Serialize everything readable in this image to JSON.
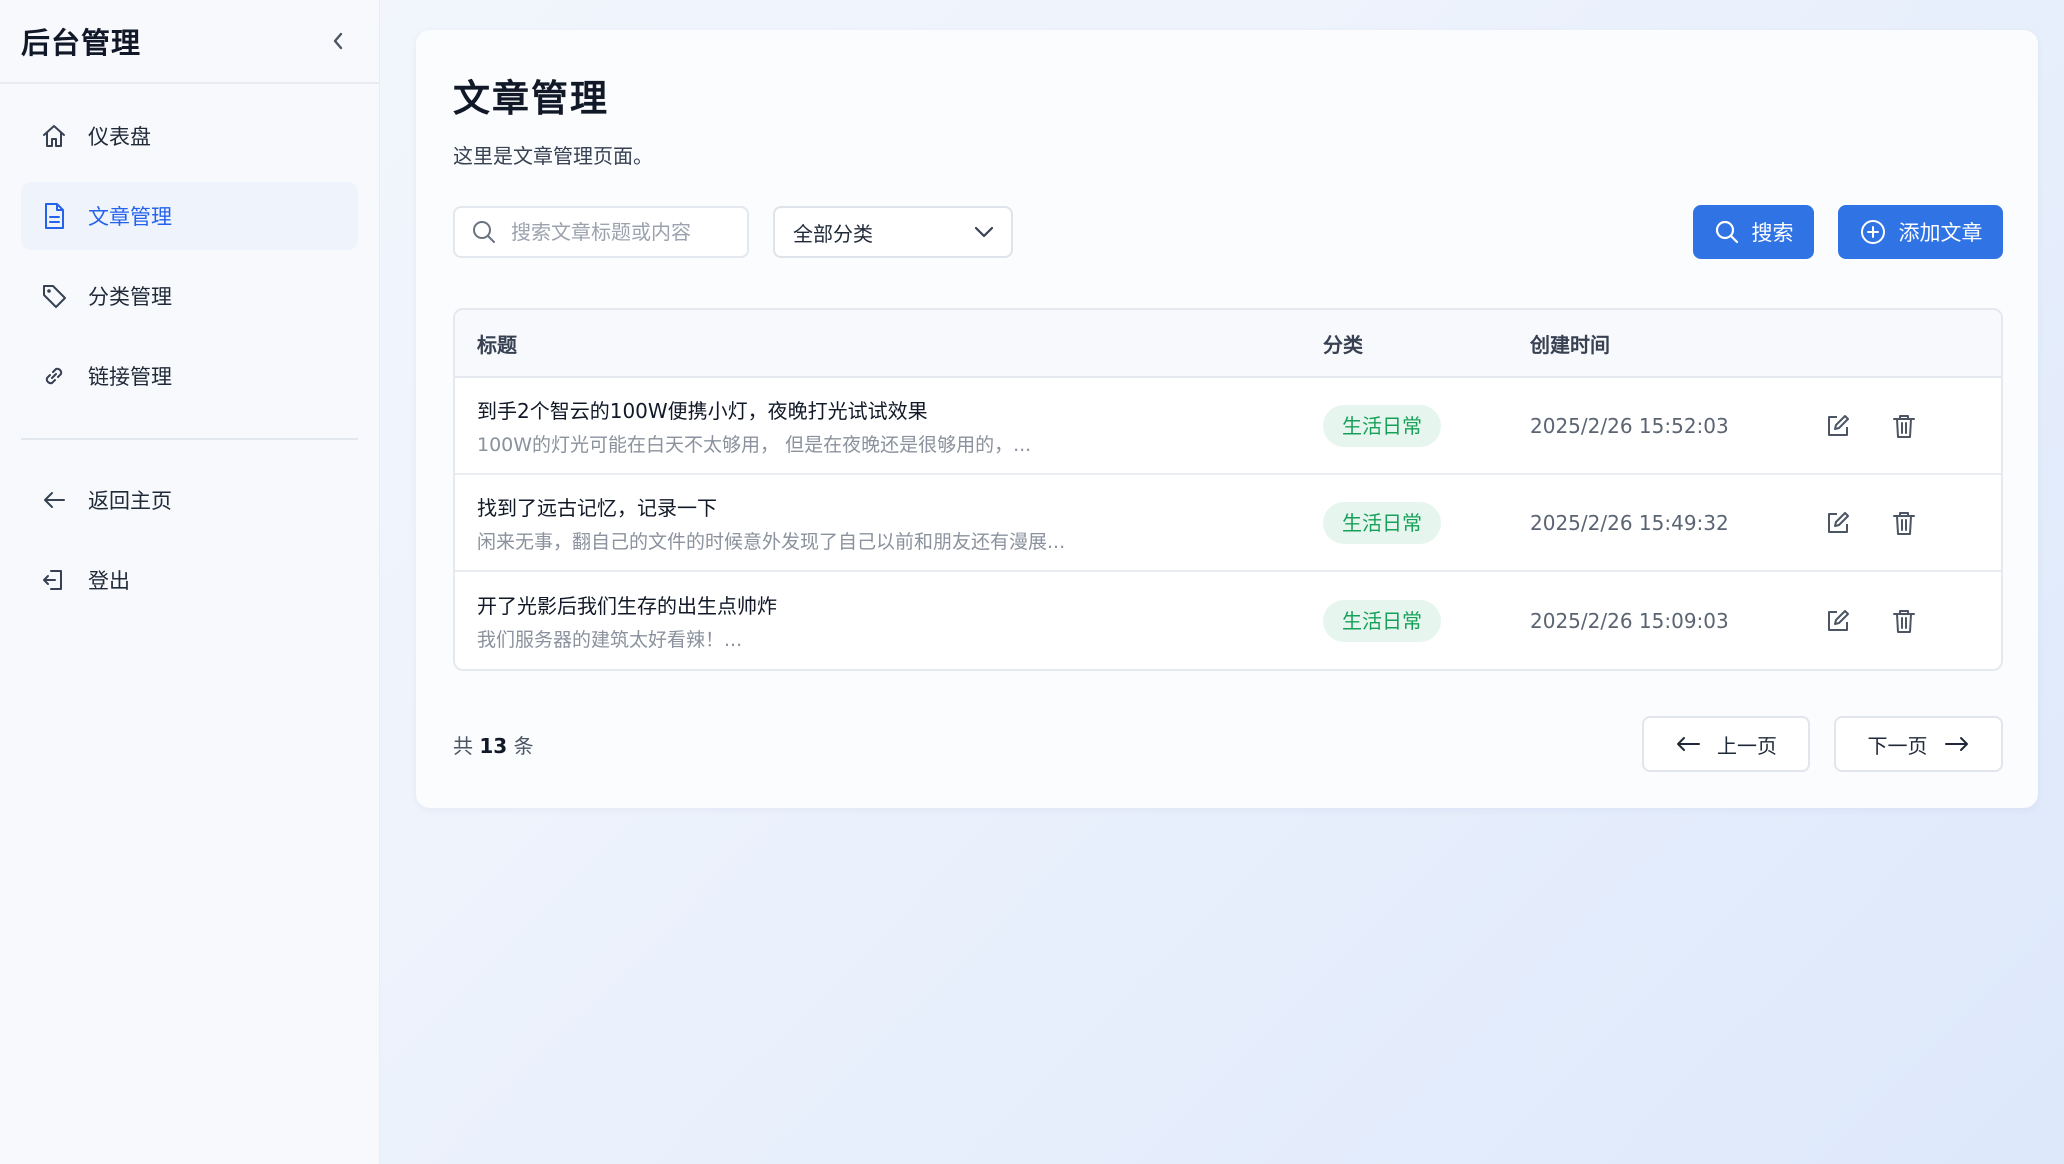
{
  "sidebar": {
    "brand": "后台管理",
    "items": [
      {
        "label": "仪表盘",
        "icon": "home-icon"
      },
      {
        "label": "文章管理",
        "icon": "document-icon",
        "active": true
      },
      {
        "label": "分类管理",
        "icon": "tag-icon"
      },
      {
        "label": "链接管理",
        "icon": "link-icon"
      }
    ],
    "bottom_items": [
      {
        "label": "返回主页",
        "icon": "arrow-left-icon"
      },
      {
        "label": "登出",
        "icon": "logout-icon"
      }
    ]
  },
  "main": {
    "title": "文章管理",
    "description": "这里是文章管理页面。",
    "search": {
      "placeholder": "搜索文章标题或内容",
      "value": ""
    },
    "category_select": {
      "selected": "全部分类"
    },
    "search_button": "搜索",
    "add_button": "添加文章",
    "table": {
      "headers": [
        "标题",
        "分类",
        "创建时间"
      ],
      "rows": [
        {
          "title": "到手2个智云的100W便携小灯，夜晚打光试试效果",
          "excerpt": "100W的灯光可能在白天不太够用， 但是在夜晚还是很够用的，...",
          "category": "生活日常",
          "created": "2025/2/26 15:52:03"
        },
        {
          "title": "找到了远古记忆，记录一下",
          "excerpt": "闲来无事，翻自己的文件的时候意外发现了自己以前和朋友还有漫展...",
          "category": "生活日常",
          "created": "2025/2/26 15:49:32"
        },
        {
          "title": "开了光影后我们生存的出生点帅炸",
          "excerpt": "我们服务器的建筑太好看辣！...",
          "category": "生活日常",
          "created": "2025/2/26 15:09:03"
        }
      ]
    },
    "total": {
      "prefix": "共",
      "count": "13",
      "suffix": "条"
    },
    "pagination": {
      "prev": "上一页",
      "next": "下一页"
    }
  },
  "colors": {
    "accent": "#2f73e4",
    "badge_bg": "#e6f6ee",
    "badge_text": "#17a05a"
  }
}
